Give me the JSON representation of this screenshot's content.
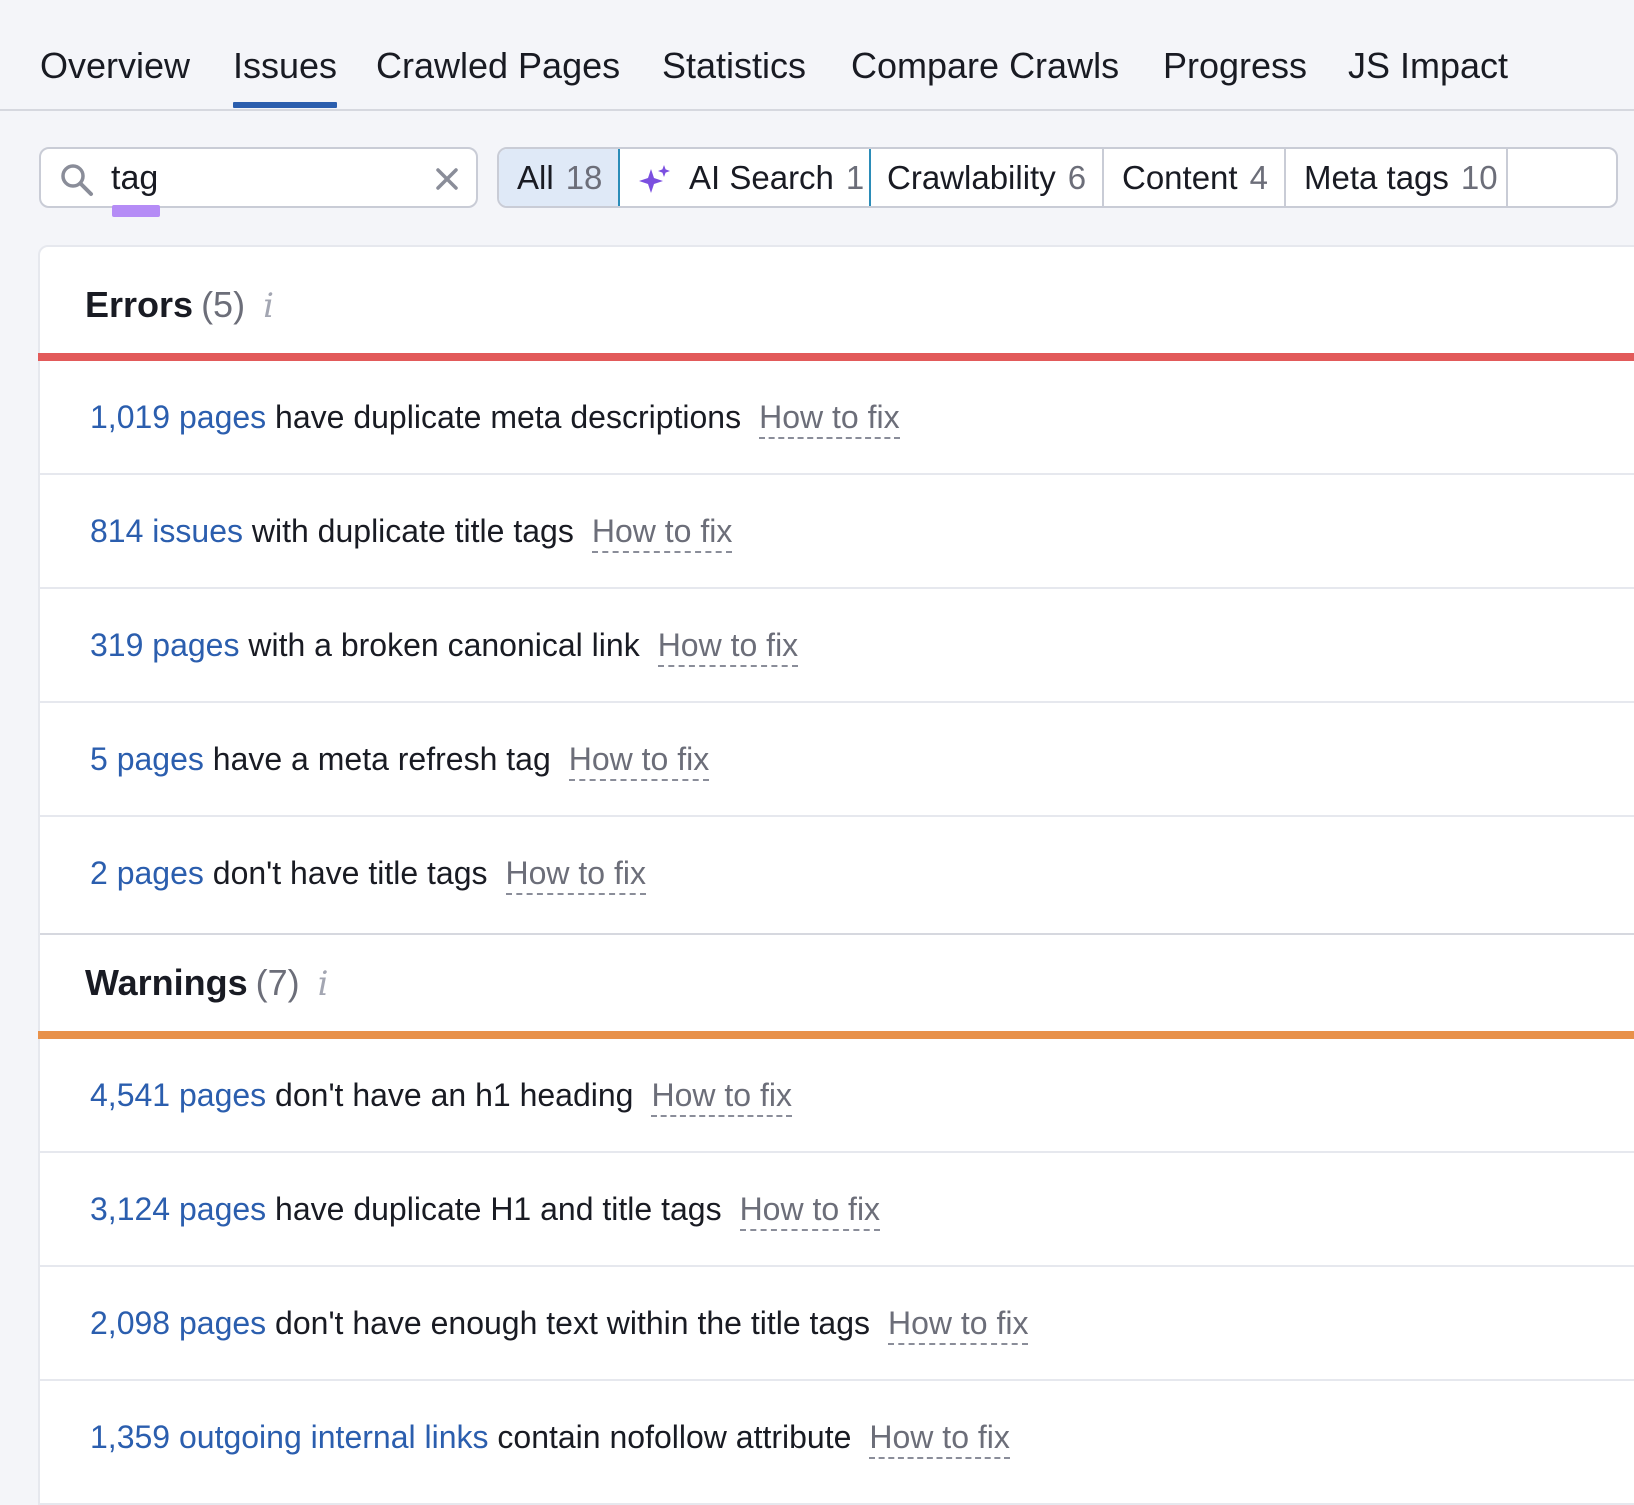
{
  "tabs": [
    {
      "label": "Overview"
    },
    {
      "label": "Issues"
    },
    {
      "label": "Crawled Pages"
    },
    {
      "label": "Statistics"
    },
    {
      "label": "Compare Crawls"
    },
    {
      "label": "Progress"
    },
    {
      "label": "JS Impact"
    }
  ],
  "active_tab": "Issues",
  "search": {
    "value": "tag"
  },
  "filters": [
    {
      "label": "All",
      "count": "18"
    },
    {
      "label": "AI Search",
      "count": "1"
    },
    {
      "label": "Crawlability",
      "count": "6"
    },
    {
      "label": "Content",
      "count": "4"
    },
    {
      "label": "Meta tags",
      "count": "10"
    }
  ],
  "colors": {
    "accent": "#2b5eae",
    "errors_bar": "#e25a5a",
    "warnings_bar": "#e8914a",
    "highlight": "#b58cf6"
  },
  "errors": {
    "title": "Errors",
    "count": "(5)",
    "items": [
      {
        "link": "1,019 pages",
        "text": "have duplicate meta descriptions",
        "fix": "How to fix"
      },
      {
        "link": "814 issues",
        "text": "with duplicate title tags",
        "fix": "How to fix"
      },
      {
        "link": "319 pages",
        "text": "with a broken canonical link",
        "fix": "How to fix"
      },
      {
        "link": "5 pages",
        "text": "have a meta refresh tag",
        "fix": "How to fix"
      },
      {
        "link": "2 pages",
        "text": "don't have title tags",
        "fix": "How to fix"
      }
    ]
  },
  "warnings": {
    "title": "Warnings",
    "count": "(7)",
    "items": [
      {
        "link": "4,541 pages",
        "text": "don't have an h1 heading",
        "fix": "How to fix"
      },
      {
        "link": "3,124 pages",
        "text": "have duplicate H1 and title tags",
        "fix": "How to fix"
      },
      {
        "link": "2,098 pages",
        "text": "don't have enough text within the title tags",
        "fix": "How to fix"
      },
      {
        "link": "1,359 outgoing internal links",
        "text": "contain nofollow attribute",
        "fix": "How to fix"
      }
    ]
  }
}
